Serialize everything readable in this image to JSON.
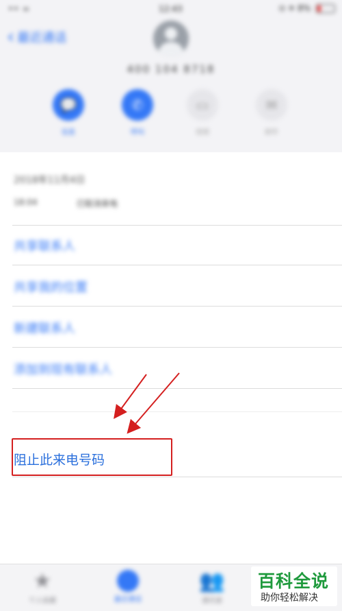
{
  "status_bar": {
    "signal": "•• ≈",
    "time": "12:43",
    "right": "⊙ ✈ 8%"
  },
  "header": {
    "back_label": "最近通话",
    "phone_number": "400 104 8718"
  },
  "actions": [
    {
      "label": "信息"
    },
    {
      "label": "呼叫"
    },
    {
      "label": "视频"
    },
    {
      "label": "邮件"
    }
  ],
  "call_info": {
    "date": "2018年11月4日",
    "time": "18:04",
    "type": "已取消来电"
  },
  "options": [
    {
      "label": "共享联系人"
    },
    {
      "label": "共享我的位置"
    },
    {
      "label": "新建联系人"
    },
    {
      "label": "添加到现有联系人"
    }
  ],
  "block": {
    "label": "阻止此来电号码"
  },
  "tabs": [
    {
      "label": "个人收藏",
      "icon": "star-icon"
    },
    {
      "label": "最近通话",
      "icon": "clock-icon"
    },
    {
      "label": "通讯录",
      "icon": "contacts-icon"
    }
  ],
  "watermark": {
    "title": "百科全说",
    "subtitle": "助你轻松解决"
  },
  "colors": {
    "accent": "#3478f6",
    "highlight_box": "#d41f1f",
    "watermark_green": "#1f9a3d"
  }
}
